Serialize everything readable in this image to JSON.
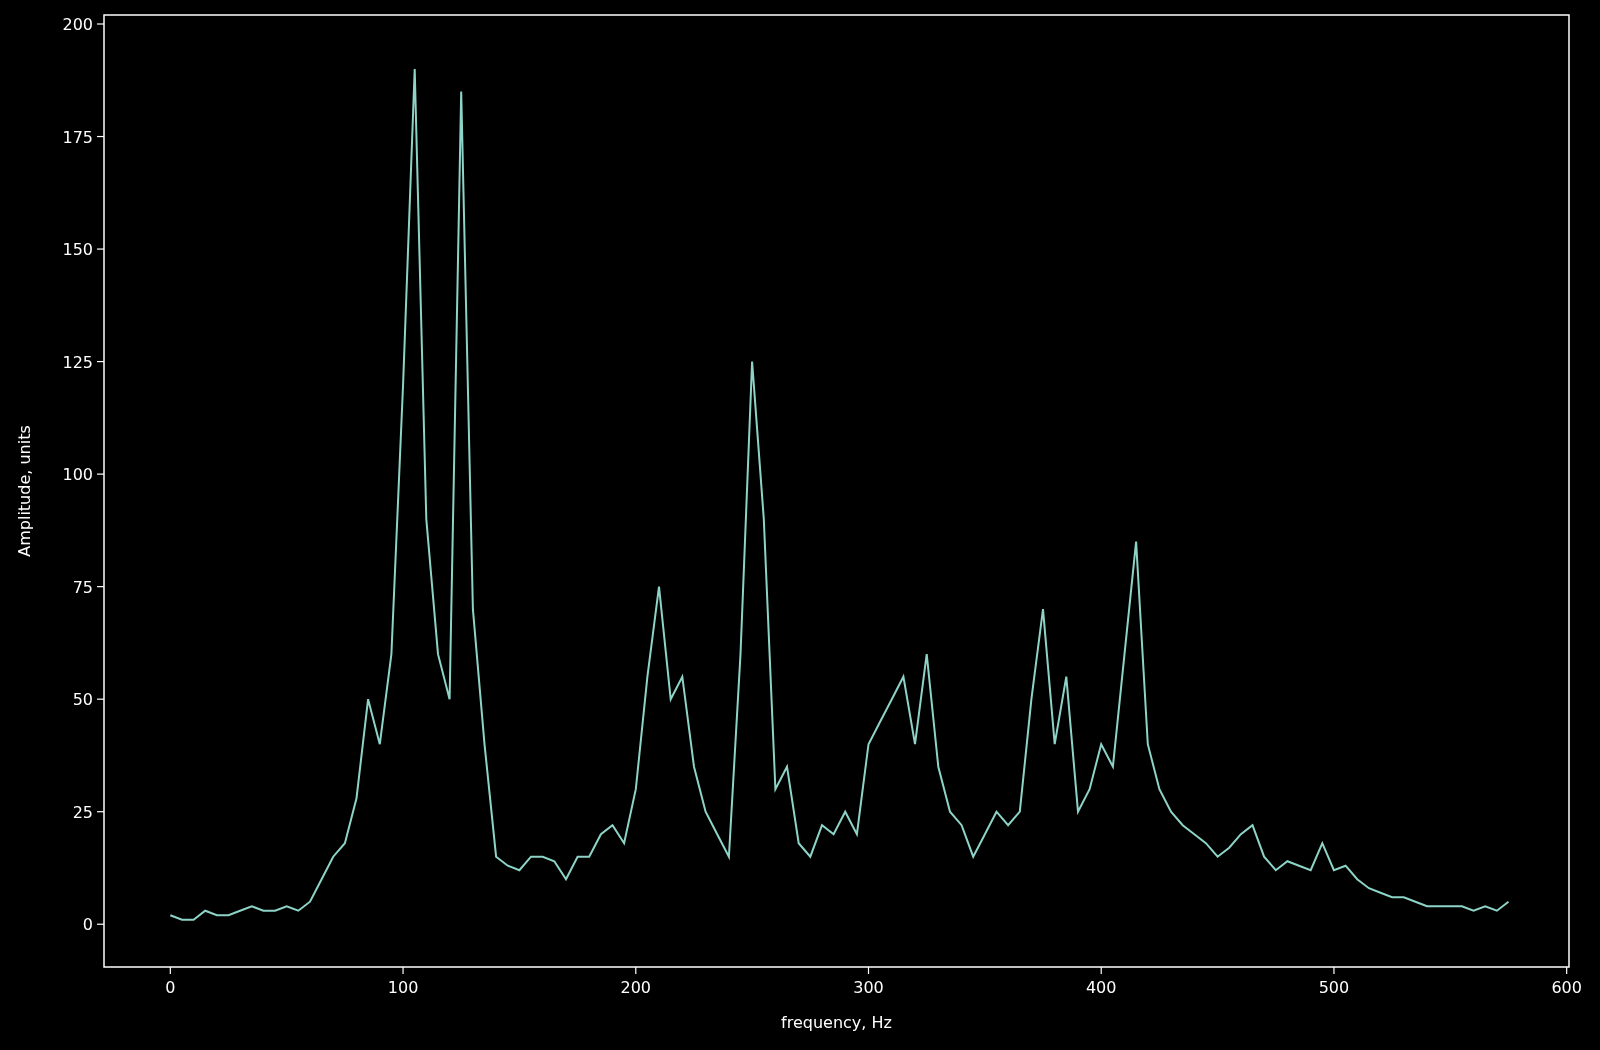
{
  "chart": {
    "chart_data": {
      "type": "line",
      "xlabel": "frequency, Hz",
      "ylabel": "Amplitude, units",
      "xlim": [
        -28.5,
        601
      ],
      "ylim": [
        -9.5,
        202
      ],
      "xticks": [
        0,
        100,
        200,
        300,
        400,
        500,
        600
      ],
      "yticks": [
        0,
        25,
        50,
        75,
        100,
        125,
        150,
        175,
        200
      ],
      "x": [
        0,
        5,
        10,
        15,
        20,
        25,
        30,
        35,
        40,
        45,
        50,
        55,
        60,
        65,
        70,
        75,
        80,
        85,
        90,
        95,
        100,
        105,
        110,
        115,
        120,
        125,
        130,
        135,
        140,
        145,
        150,
        155,
        160,
        165,
        170,
        175,
        180,
        185,
        190,
        195,
        200,
        205,
        210,
        215,
        220,
        225,
        230,
        235,
        240,
        245,
        250,
        255,
        260,
        265,
        270,
        275,
        280,
        285,
        290,
        295,
        300,
        305,
        310,
        315,
        320,
        325,
        330,
        335,
        340,
        345,
        350,
        355,
        360,
        365,
        370,
        375,
        380,
        385,
        390,
        395,
        400,
        405,
        410,
        415,
        420,
        425,
        430,
        435,
        440,
        445,
        450,
        455,
        460,
        465,
        470,
        475,
        480,
        485,
        490,
        495,
        500,
        505,
        510,
        515,
        520,
        525,
        530,
        535,
        540,
        545,
        550,
        555,
        560,
        565,
        570,
        575
      ],
      "series": [
        {
          "color": "#8dd3c7",
          "values": [
            2,
            1,
            1,
            3,
            2,
            2,
            3,
            4,
            3,
            3,
            4,
            3,
            5,
            10,
            15,
            18,
            28,
            50,
            40,
            60,
            120,
            190,
            90,
            60,
            50,
            185,
            70,
            40,
            15,
            13,
            12,
            15,
            15,
            14,
            10,
            15,
            15,
            20,
            22,
            18,
            30,
            55,
            75,
            50,
            55,
            35,
            25,
            20,
            15,
            60,
            125,
            90,
            30,
            35,
            18,
            15,
            22,
            20,
            25,
            20,
            40,
            45,
            50,
            55,
            40,
            60,
            35,
            25,
            22,
            15,
            20,
            25,
            22,
            25,
            50,
            70,
            40,
            55,
            25,
            30,
            40,
            35,
            60,
            85,
            40,
            30,
            25,
            22,
            20,
            18,
            15,
            17,
            20,
            22,
            15,
            12,
            14,
            13,
            12,
            18,
            12,
            13,
            10,
            8,
            7,
            6,
            6,
            5,
            4,
            4,
            4,
            4,
            3,
            4,
            3,
            5
          ]
        }
      ]
    }
  }
}
